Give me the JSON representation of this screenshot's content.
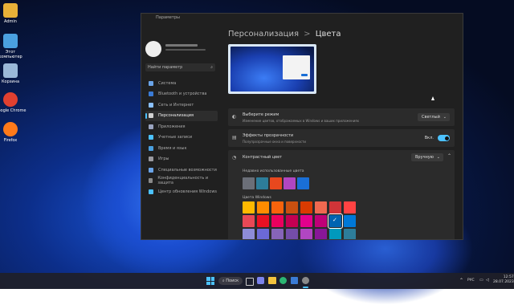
{
  "desktop": {
    "icons": [
      {
        "label": "Admin",
        "color": "#e8b038"
      },
      {
        "label": "Этот компьютер",
        "color": "#4aa0e0"
      },
      {
        "label": "Корзина",
        "color": "#9ab8d8"
      },
      {
        "label": "Google Chrome",
        "color": "#e04030"
      },
      {
        "label": "Firefox",
        "color": "#ff7a1a"
      }
    ]
  },
  "window": {
    "title": "Параметры",
    "search_placeholder": "Найти параметр",
    "nav": [
      {
        "label": "Система",
        "active": false
      },
      {
        "label": "Bluetooth и устройства",
        "active": false
      },
      {
        "label": "Сеть и Интернет",
        "active": false
      },
      {
        "label": "Персонализация",
        "active": true
      },
      {
        "label": "Приложения",
        "active": false
      },
      {
        "label": "Учетные записи",
        "active": false
      },
      {
        "label": "Время и язык",
        "active": false
      },
      {
        "label": "Игры",
        "active": false
      },
      {
        "label": "Специальные возможности",
        "active": false
      },
      {
        "label": "Конфиденциальность и защита",
        "active": false
      },
      {
        "label": "Центр обновления Windows",
        "active": false
      }
    ]
  },
  "header": {
    "breadcrumb_parent": "Персонализация",
    "breadcrumb_sep": ">",
    "breadcrumb_current": "Цвета"
  },
  "mode": {
    "title": "Выберите режим",
    "subtitle": "Изменение цветов, отображаемых в Windows и ваших приложениях",
    "value": "Светлый"
  },
  "transparency": {
    "title": "Эффекты прозрачности",
    "subtitle": "Полупрозрачные окна и поверхности",
    "state": "Вкл."
  },
  "accent": {
    "title": "Контрастный цвет",
    "value": "Вручную"
  },
  "recent": {
    "label": "Недавно использованные цвета",
    "colors": [
      "#6b6f78",
      "#2d7d9a",
      "#e8481e",
      "#b146c2",
      "#1a6fd6"
    ]
  },
  "windows_colors": {
    "label": "Цвета Windows",
    "rows": [
      [
        "#ffb900",
        "#ff8c00",
        "#f7630c",
        "#ca5010",
        "#da3b01",
        "#ef6950",
        "#d13438",
        "#ff4343"
      ],
      [
        "#e74856",
        "#e81123",
        "#ea005e",
        "#c30052",
        "#e3008c",
        "#bf0077",
        "#0063b1",
        "#0078d7"
      ],
      [
        "#8e8cd8",
        "#6b69d6",
        "#8764b8",
        "#744da9",
        "#b146c2",
        "#881798",
        "#0099bc",
        "#2d7d9a"
      ],
      [
        "#00b7c3",
        "#038387",
        "#00b294",
        "#018574",
        "#00cc6a",
        "#10893e",
        "#7a7574",
        "#5d5a58"
      ]
    ],
    "selected": "#0063b1"
  },
  "taskbar": {
    "search_label": "Поиск",
    "lang": "РУС",
    "time": "12:57",
    "date": "28.07.2023"
  }
}
